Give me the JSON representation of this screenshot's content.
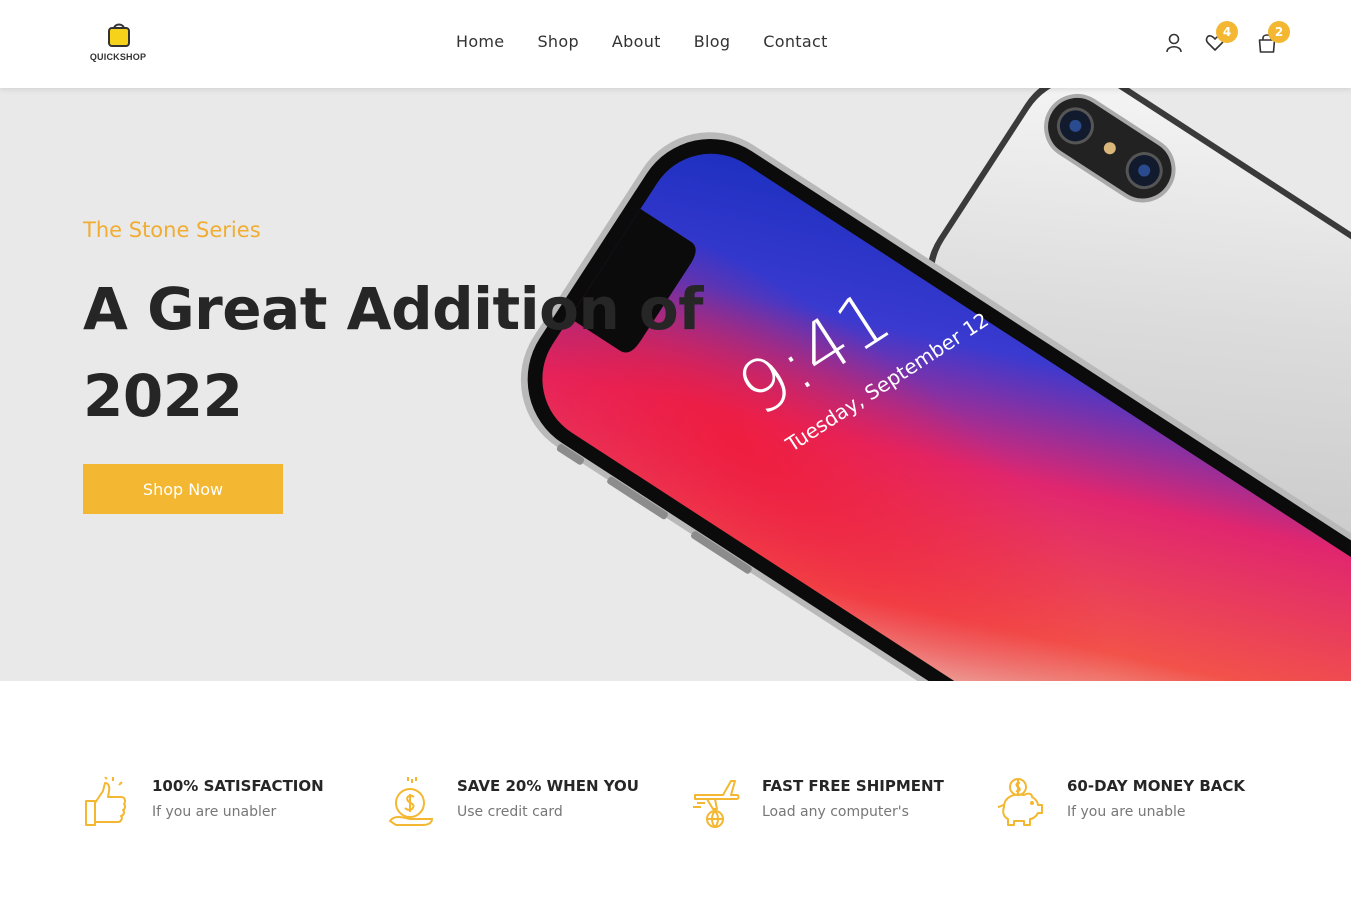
{
  "brand": {
    "logo_text_quick": "QUICK",
    "logo_text_shop": "SHOP"
  },
  "nav": {
    "items": [
      "Home",
      "Shop",
      "About",
      "Blog",
      "Contact"
    ]
  },
  "header_icons": {
    "account_icon": "user-icon",
    "wishlist_icon": "heart-icon",
    "wishlist_count": "4",
    "cart_icon": "shopping-bag-icon",
    "cart_count": "2"
  },
  "hero": {
    "subtitle": "The Stone Series",
    "headline": "A Great Addition of 2022",
    "button_label": "Shop Now",
    "phone_time": "9:41",
    "phone_date": "Tuesday, September 12"
  },
  "features": [
    {
      "icon": "thumbs-up-icon",
      "title": "100% SATISFACTION",
      "desc": "If you are unabler"
    },
    {
      "icon": "coin-hand-icon",
      "title": "SAVE 20% WHEN YOU",
      "desc": "Use credit card"
    },
    {
      "icon": "plane-globe-icon",
      "title": "FAST FREE SHIPMENT",
      "desc": "Load any computer's"
    },
    {
      "icon": "piggy-bank-icon",
      "title": "60-DAY MONEY BACK",
      "desc": "If you are unable"
    }
  ],
  "colors": {
    "accent": "#f3b731",
    "hero_bg": "#e9e9e9",
    "text_dark": "#262626",
    "text_muted": "#777777"
  }
}
